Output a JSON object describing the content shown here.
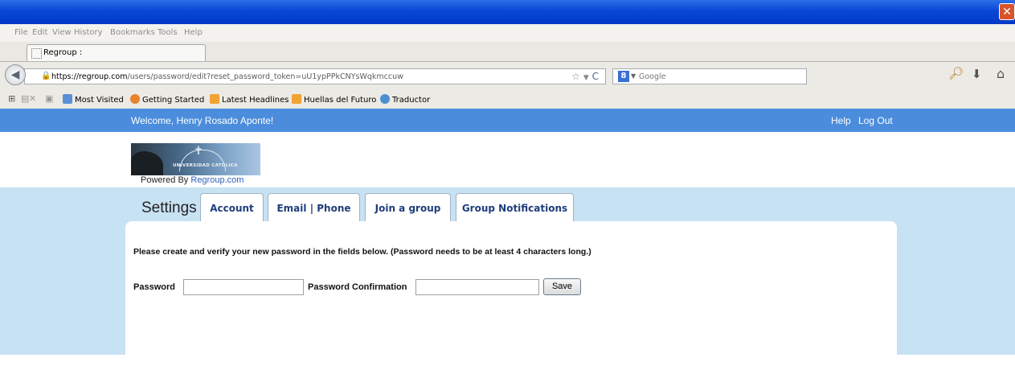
{
  "browser": {
    "menu": [
      "File",
      "Edit",
      "View",
      "History",
      "Bookmarks",
      "Tools",
      "Help"
    ],
    "tab_title": "Regroup :",
    "url_host": "https://regroup.com",
    "url_path": "/users/password/edit?reset_password_token=uU1ypPPkCNYsWqkmccuw",
    "search_placeholder": "Google",
    "bookmarks": [
      "Most Visited",
      "Getting Started",
      "Latest Headlines",
      "Huellas del Futuro",
      "Traductor"
    ]
  },
  "site": {
    "welcome": "Welcome, Henry Rosado Aponte!",
    "help": "Help",
    "logout": "Log Out",
    "logo_text": "UNIVERSIDAD CATÓLICA",
    "powered_by": "Powered By ",
    "powered_link": "Regroup.com"
  },
  "settings": {
    "title": "Settings",
    "tabs": [
      "Account",
      "Email | Phone",
      "Join a group",
      "Group Notifications"
    ],
    "instructions": "Please create and verify your new password in the fields below. (Password needs to be at least 4 characters long.)",
    "password_label": "Password",
    "password_value": "",
    "confirm_label": "Password Confirmation",
    "confirm_value": "",
    "save_label": "Save"
  },
  "colors": {
    "title_bar": "#0a46d6",
    "site_bar": "#4b8ddc",
    "content_bg": "#c7e2f3",
    "tab_text": "#1f3d7a"
  }
}
